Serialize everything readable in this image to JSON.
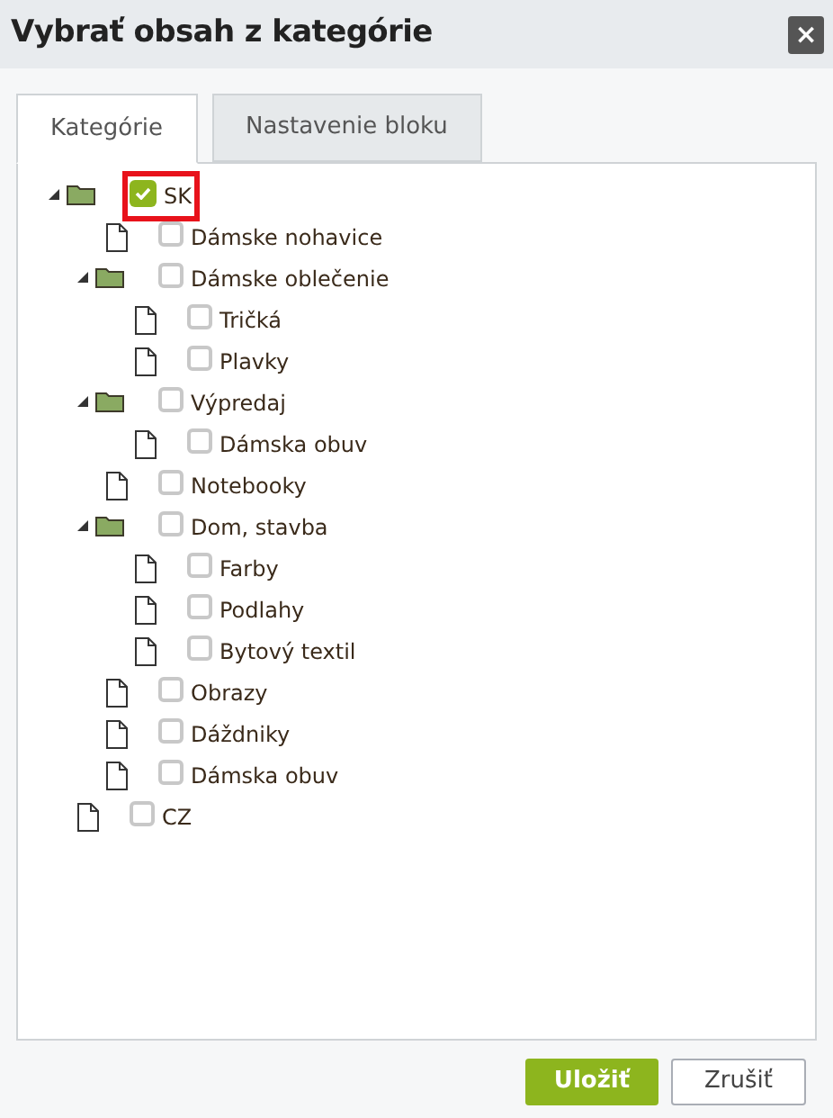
{
  "window": {
    "title": "Vybrať obsah z kategórie",
    "close_label": "×"
  },
  "tabs": [
    {
      "label": "Kategórie",
      "selected": true
    },
    {
      "label": "Nastavenie bloku",
      "selected": false
    }
  ],
  "tree": [
    {
      "kind": "folder",
      "label": "SK",
      "checked": true,
      "highlighted": true,
      "expanded": true,
      "children": [
        {
          "kind": "page",
          "label": "Dámske nohavice",
          "checked": false,
          "highlighted": false
        },
        {
          "kind": "folder",
          "label": "Dámske oblečenie",
          "checked": false,
          "highlighted": false,
          "expanded": true,
          "children": [
            {
              "kind": "page",
              "label": "Tričká",
              "checked": false,
              "highlighted": false
            },
            {
              "kind": "page",
              "label": "Plavky",
              "checked": false,
              "highlighted": false
            }
          ]
        },
        {
          "kind": "folder",
          "label": "Výpredaj",
          "checked": false,
          "highlighted": false,
          "expanded": true,
          "children": [
            {
              "kind": "page",
              "label": "Dámska obuv",
              "checked": false,
              "highlighted": false
            }
          ]
        },
        {
          "kind": "page",
          "label": "Notebooky",
          "checked": false,
          "highlighted": false
        },
        {
          "kind": "folder",
          "label": "Dom, stavba",
          "checked": false,
          "highlighted": false,
          "expanded": true,
          "children": [
            {
              "kind": "page",
              "label": "Farby",
              "checked": false,
              "highlighted": false
            },
            {
              "kind": "page",
              "label": "Podlahy",
              "checked": false,
              "highlighted": false
            },
            {
              "kind": "page",
              "label": "Bytový textil",
              "checked": false,
              "highlighted": false
            }
          ]
        },
        {
          "kind": "page",
          "label": "Obrazy",
          "checked": false,
          "highlighted": false
        },
        {
          "kind": "page",
          "label": "Dáždniky",
          "checked": false,
          "highlighted": false
        },
        {
          "kind": "page",
          "label": "Dámska obuv",
          "checked": false,
          "highlighted": false
        }
      ]
    },
    {
      "kind": "page",
      "label": "CZ",
      "checked": false,
      "highlighted": false
    }
  ],
  "buttons": [
    {
      "kind": "primary",
      "label": "Uložiť"
    },
    {
      "kind": "secondary",
      "label": "Zrušiť"
    }
  ]
}
